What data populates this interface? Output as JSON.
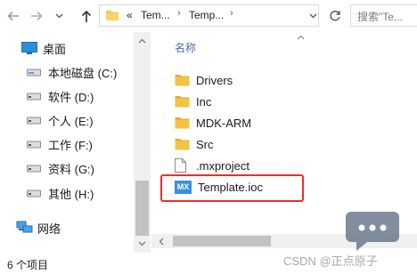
{
  "toolbar": {
    "back_icon": "arrow-left-icon",
    "forward_icon": "arrow-right-icon",
    "recent_icon": "chevron-down-icon",
    "up_icon": "arrow-up-icon",
    "address": {
      "overflow_label": "«",
      "segments": [
        "Tem...",
        "Temp..."
      ],
      "separator": "›"
    },
    "refresh_icon": "refresh-icon",
    "search_placeholder": "搜索\"Te..."
  },
  "nav": {
    "items": [
      {
        "label": "桌面",
        "icon": "desktop-icon"
      },
      {
        "label": "本地磁盘 (C:)",
        "icon": "drive-icon"
      },
      {
        "label": "软件 (D:)",
        "icon": "drive-icon"
      },
      {
        "label": "个人 (E:)",
        "icon": "drive-icon"
      },
      {
        "label": "工作 (F:)",
        "icon": "drive-icon"
      },
      {
        "label": "资料 (G:)",
        "icon": "drive-icon"
      },
      {
        "label": "其他 (H:)",
        "icon": "drive-icon"
      },
      {
        "label": "网络",
        "icon": "network-icon"
      }
    ]
  },
  "content": {
    "column_header": "名称",
    "files": [
      {
        "name": "Drivers",
        "type": "folder"
      },
      {
        "name": "Inc",
        "type": "folder"
      },
      {
        "name": "MDK-ARM",
        "type": "folder"
      },
      {
        "name": "Src",
        "type": "folder"
      },
      {
        "name": ".mxproject",
        "type": "file"
      },
      {
        "name": "Template.ioc",
        "type": "mx"
      }
    ],
    "mx_badge": "MX"
  },
  "status": {
    "item_count": "6 个项目"
  },
  "watermark": {
    "text": "CSDN @正点原子"
  },
  "colors": {
    "folder": "#f5c243",
    "highlight": "#e8302a",
    "header": "#4a6ea9",
    "mx": "#3a8ee6"
  }
}
